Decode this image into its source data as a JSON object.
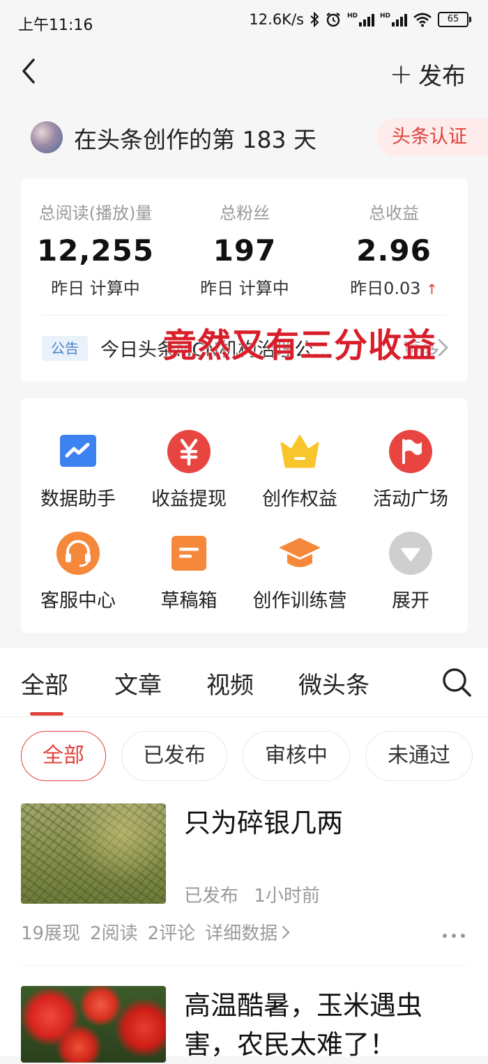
{
  "status_bar": {
    "time": "上午11:16",
    "net_speed": "12.6K/s",
    "battery": "65",
    "hd1": "HD",
    "hd2": "HD"
  },
  "header": {
    "back_icon": "chevron-left-icon",
    "publish_plus": "+",
    "publish_label": "发布"
  },
  "creator": {
    "days_text": "在头条创作的第 183 天",
    "cert_label": "头条认证"
  },
  "stats": [
    {
      "label": "总阅读(播放)量",
      "value": "12,255",
      "sub": "昨日 计算中"
    },
    {
      "label": "总粉丝",
      "value": "197",
      "sub": "昨日 计算中"
    },
    {
      "label": "总收益",
      "value": "2.96",
      "sub": "昨日0.03",
      "trend": "↑"
    }
  ],
  "notice": {
    "tag": "公告",
    "text": "今日头条MCN机构治理公…",
    "more": "更多",
    "overlay_text": "竟然又有三分收益"
  },
  "tools": [
    {
      "label": "数据助手",
      "icon": "chart-icon"
    },
    {
      "label": "收益提现",
      "icon": "yuan-icon"
    },
    {
      "label": "创作权益",
      "icon": "crown-icon"
    },
    {
      "label": "活动广场",
      "icon": "flag-icon"
    },
    {
      "label": "客服中心",
      "icon": "headset-icon"
    },
    {
      "label": "草稿箱",
      "icon": "draft-icon"
    },
    {
      "label": "创作训练营",
      "icon": "graduation-cap-icon"
    },
    {
      "label": "展开",
      "icon": "expand-icon"
    }
  ],
  "tabs": [
    "全部",
    "文章",
    "视频",
    "微头条"
  ],
  "filters": [
    "全部",
    "已发布",
    "审核中",
    "未通过"
  ],
  "articles": [
    {
      "title": "只为碎银几两",
      "status": "已发布",
      "time": "1小时前",
      "impressions": "19展现",
      "reads": "2阅读",
      "comments": "2评论",
      "detail": "详细数据"
    },
    {
      "title": "高温酷暑，玉米遇虫害，农民太难了！"
    }
  ],
  "colors": {
    "accent": "#e0413a",
    "chart_blue": "#3c82f0",
    "orange": "#f5883a",
    "gold": "#f8c52c",
    "gray_icon": "#cfcfcf"
  }
}
